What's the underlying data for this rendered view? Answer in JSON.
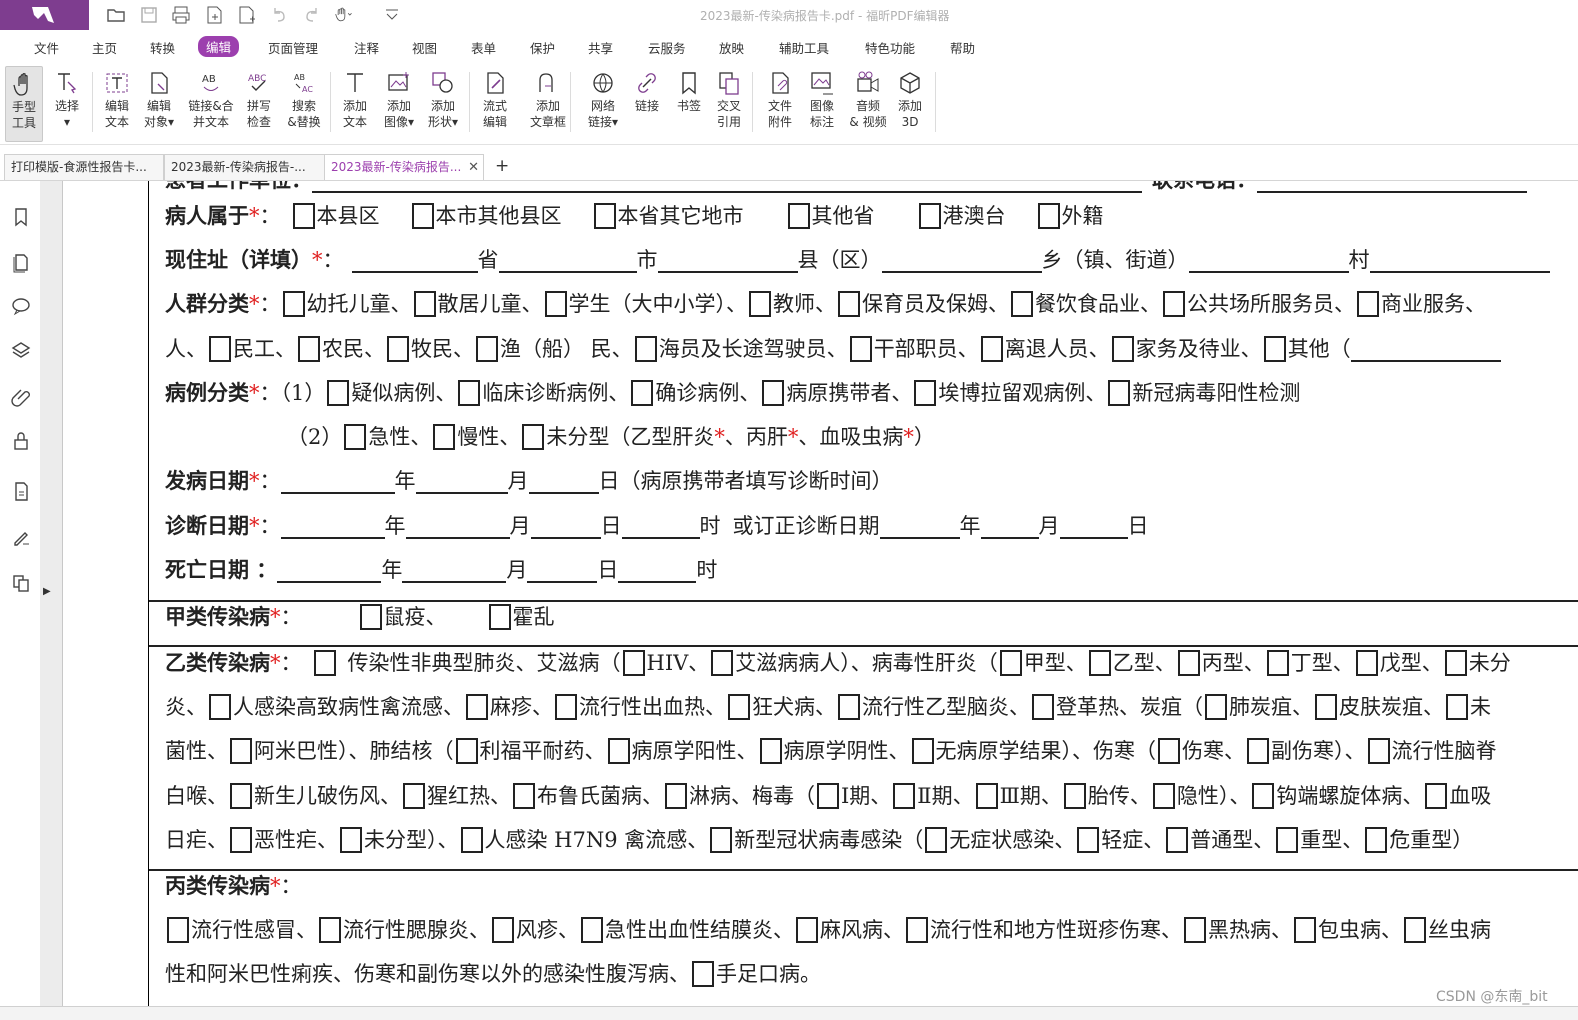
{
  "window": {
    "title": "2023最新-传染病报告卡.pdf - 福昕PDF编辑器"
  },
  "menu": [
    "文件",
    "主页",
    "转换",
    "编辑",
    "页面管理",
    "注释",
    "视图",
    "表单",
    "保护",
    "共享",
    "云服务",
    "放映",
    "辅助工具",
    "特色功能",
    "帮助"
  ],
  "menu_active": "编辑",
  "ribbon": [
    {
      "label": "手型\n工具",
      "icon": "hand-icon",
      "active": true
    },
    {
      "label": "选择\n▾",
      "icon": "select-text-icon"
    },
    {
      "label": "编辑\n文本",
      "icon": "edit-text-icon"
    },
    {
      "label": "编辑\n对象▾",
      "icon": "edit-object-icon"
    },
    {
      "label": "链接&合\n并文本",
      "icon": "link-merge-text-icon"
    },
    {
      "label": "拼写\n检查",
      "icon": "spell-check-icon"
    },
    {
      "label": "搜索\n&替换",
      "icon": "search-replace-icon"
    },
    {
      "label": "添加\n文本",
      "icon": "add-text-icon"
    },
    {
      "label": "添加\n图像▾",
      "icon": "add-image-icon"
    },
    {
      "label": "添加\n形状▾",
      "icon": "add-shape-icon"
    },
    {
      "label": "流式\n编辑",
      "icon": "flow-edit-icon"
    },
    {
      "label": "添加\n文章框",
      "icon": "article-box-icon"
    },
    {
      "label": "网络\n链接▾",
      "icon": "web-link-icon"
    },
    {
      "label": "链接",
      "icon": "link-icon"
    },
    {
      "label": "书签",
      "icon": "bookmark-icon"
    },
    {
      "label": "交叉\n引用",
      "icon": "cross-reference-icon"
    },
    {
      "label": "文件\n附件",
      "icon": "file-attachment-icon"
    },
    {
      "label": "图像\n标注",
      "icon": "image-annotation-icon"
    },
    {
      "label": "音频\n& 视频",
      "icon": "audio-video-icon"
    },
    {
      "label": "添加\n3D",
      "icon": "add-3d-icon"
    }
  ],
  "tabs": [
    {
      "label": "打印模版-食源性报告卡..."
    },
    {
      "label": "2023最新-传染病报告-..."
    },
    {
      "label": "2023最新-传染病报告...",
      "active": true
    }
  ],
  "tab_close": "✕",
  "tab_add": "+",
  "doc": {
    "l1": {
      "label": "病人属于",
      "opts": [
        "本县区",
        "本市其他县区",
        "本省其它地市",
        "其他省",
        "港澳台",
        "外籍"
      ]
    },
    "l2": {
      "label": "现住址（详填）",
      "parts": [
        "省",
        "市",
        "县（区）",
        "乡（镇、街道）",
        "村"
      ]
    },
    "l3": {
      "label": "人群分类",
      "opts": [
        "幼托儿童、",
        "散居儿童、",
        "学生（大中小学）、",
        "教师、",
        "保育员及保姆、",
        "餐饮食品业、",
        "公共场所服务员、",
        "商业服务、"
      ]
    },
    "l4": {
      "prefix": "人、",
      "opts": [
        "民工、",
        "农民、",
        "牧民、",
        "渔（船） 民、",
        "海员及长途驾驶员、",
        "干部职员、",
        "离退人员、",
        "家务及待业、",
        "其他（"
      ]
    },
    "l5": {
      "label": "病例分类",
      "num": "（1）",
      "opts": [
        "疑似病例、",
        "临床诊断病例、",
        "确诊病例、",
        "病原携带者、",
        "埃博拉留观病例、",
        "新冠病毒阳性检测"
      ]
    },
    "l6": {
      "num": "（2）",
      "opts": [
        "急性、",
        "慢性、"
      ],
      "last": "未分型（乙型肝炎",
      "parts": [
        "、丙肝",
        "、血吸虫病",
        "）"
      ]
    },
    "l7": {
      "label": "发病日期",
      "parts": [
        "年",
        "月",
        "日（病原携带者填写诊断时间）"
      ]
    },
    "l8": {
      "label": "诊断日期",
      "parts": [
        "年",
        "月",
        "日",
        "时",
        "或订正诊断日期",
        "年",
        "月",
        "日"
      ]
    },
    "l9": {
      "label": "死亡日期 ：",
      "parts": [
        "年",
        "月",
        "日",
        "时"
      ]
    },
    "l10": {
      "label": "甲类传染病",
      "opts": [
        "鼠疫、",
        "霍乱"
      ]
    },
    "l11": {
      "label": "乙类传染病",
      "a": "传染性非典型肺炎、艾滋病（",
      "opts": [
        "HIV、",
        "艾滋病病人）、病毒性肝炎（",
        "甲型、",
        "乙型、",
        "丙型、",
        "丁型、",
        "戊型、",
        "未分"
      ]
    },
    "l12": {
      "prefix": "炎、",
      "opts": [
        "人感染高致病性禽流感、",
        "麻疹、",
        "流行性出血热、",
        "狂犬病、",
        "流行性乙型脑炎、",
        "登革热、炭疽（",
        "肺炭疽、",
        "皮肤炭疽、",
        "未"
      ]
    },
    "l13": {
      "prefix": "菌性、",
      "opts": [
        "阿米巴性）、肺结核（",
        "利福平耐药、",
        "病原学阳性、",
        "病原学阴性、",
        "无病原学结果）、伤寒（",
        "伤寒、",
        "副伤寒）、",
        "流行性脑脊"
      ]
    },
    "l14": {
      "prefix": "白喉、",
      "opts": [
        "新生儿破伤风、",
        "猩红热、",
        "布鲁氏菌病、",
        "淋病、梅毒（",
        "Ⅰ期、",
        "Ⅱ期、",
        "Ⅲ期、",
        "胎传、",
        "隐性）、",
        "钩端螺旋体病、",
        "血吸"
      ]
    },
    "l15": {
      "prefix": "日疟、",
      "opts": [
        "恶性疟、",
        "未分型）、",
        "人感染 H7N9 禽流感、",
        "新型冠状病毒感染（",
        "无症状感染、",
        "轻症、",
        "普通型、",
        "重型、",
        "危重型）"
      ]
    },
    "l16": {
      "label": "丙类传染病"
    },
    "l17": {
      "opts": [
        "流行性感冒、",
        "流行性腮腺炎、",
        "风疹、",
        "急性出血性结膜炎、",
        "麻风病、",
        "流行性和地方性斑疹伤寒、",
        "黑热病、",
        "包虫病、",
        "丝虫病"
      ]
    },
    "l18": {
      "a": "性和阿米巴性痢疾、伤寒和副伤寒以外的感染性腹泻病、",
      "opts": [
        "手足口病。"
      ]
    },
    "required_mark": "*",
    "colon": "：",
    "top_cut": {
      "a": "患者工作单位：",
      "b": "联系电话："
    }
  },
  "watermark": "CSDN @东南_bit",
  "colors": {
    "accent": "#9c3fae",
    "logo_bg": "#7e3d8f",
    "required": "#e02020"
  }
}
